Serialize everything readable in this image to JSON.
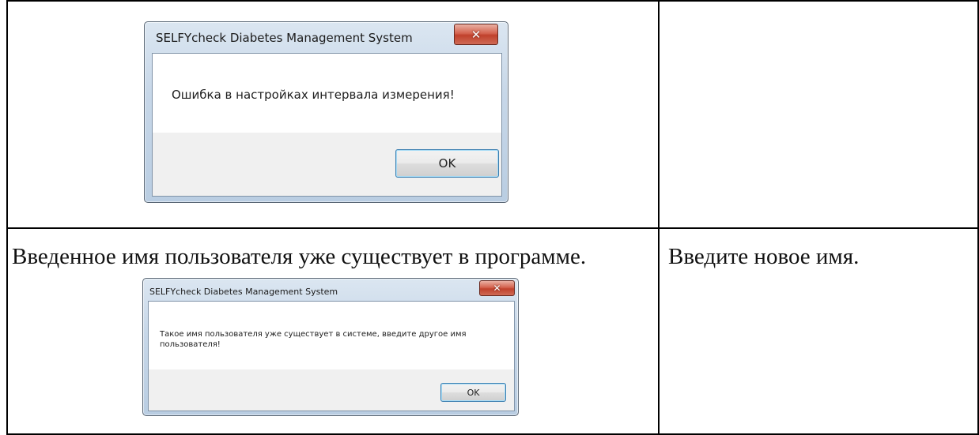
{
  "dialog1": {
    "title": "SELFYcheck Diabetes Management System",
    "close_glyph": "✕",
    "message": "Ошибка в настройках интервала измерения!",
    "ok_label": "OK"
  },
  "row2": {
    "description": "Введенное имя пользователя уже существует в программе.",
    "action": "Введите новое имя."
  },
  "dialog2": {
    "title": "SELFYcheck Diabetes Management System",
    "close_glyph": "✕",
    "message": "Такое имя пользователя уже существует в системе, введите другое имя пользователя!",
    "ok_label": "OK"
  }
}
